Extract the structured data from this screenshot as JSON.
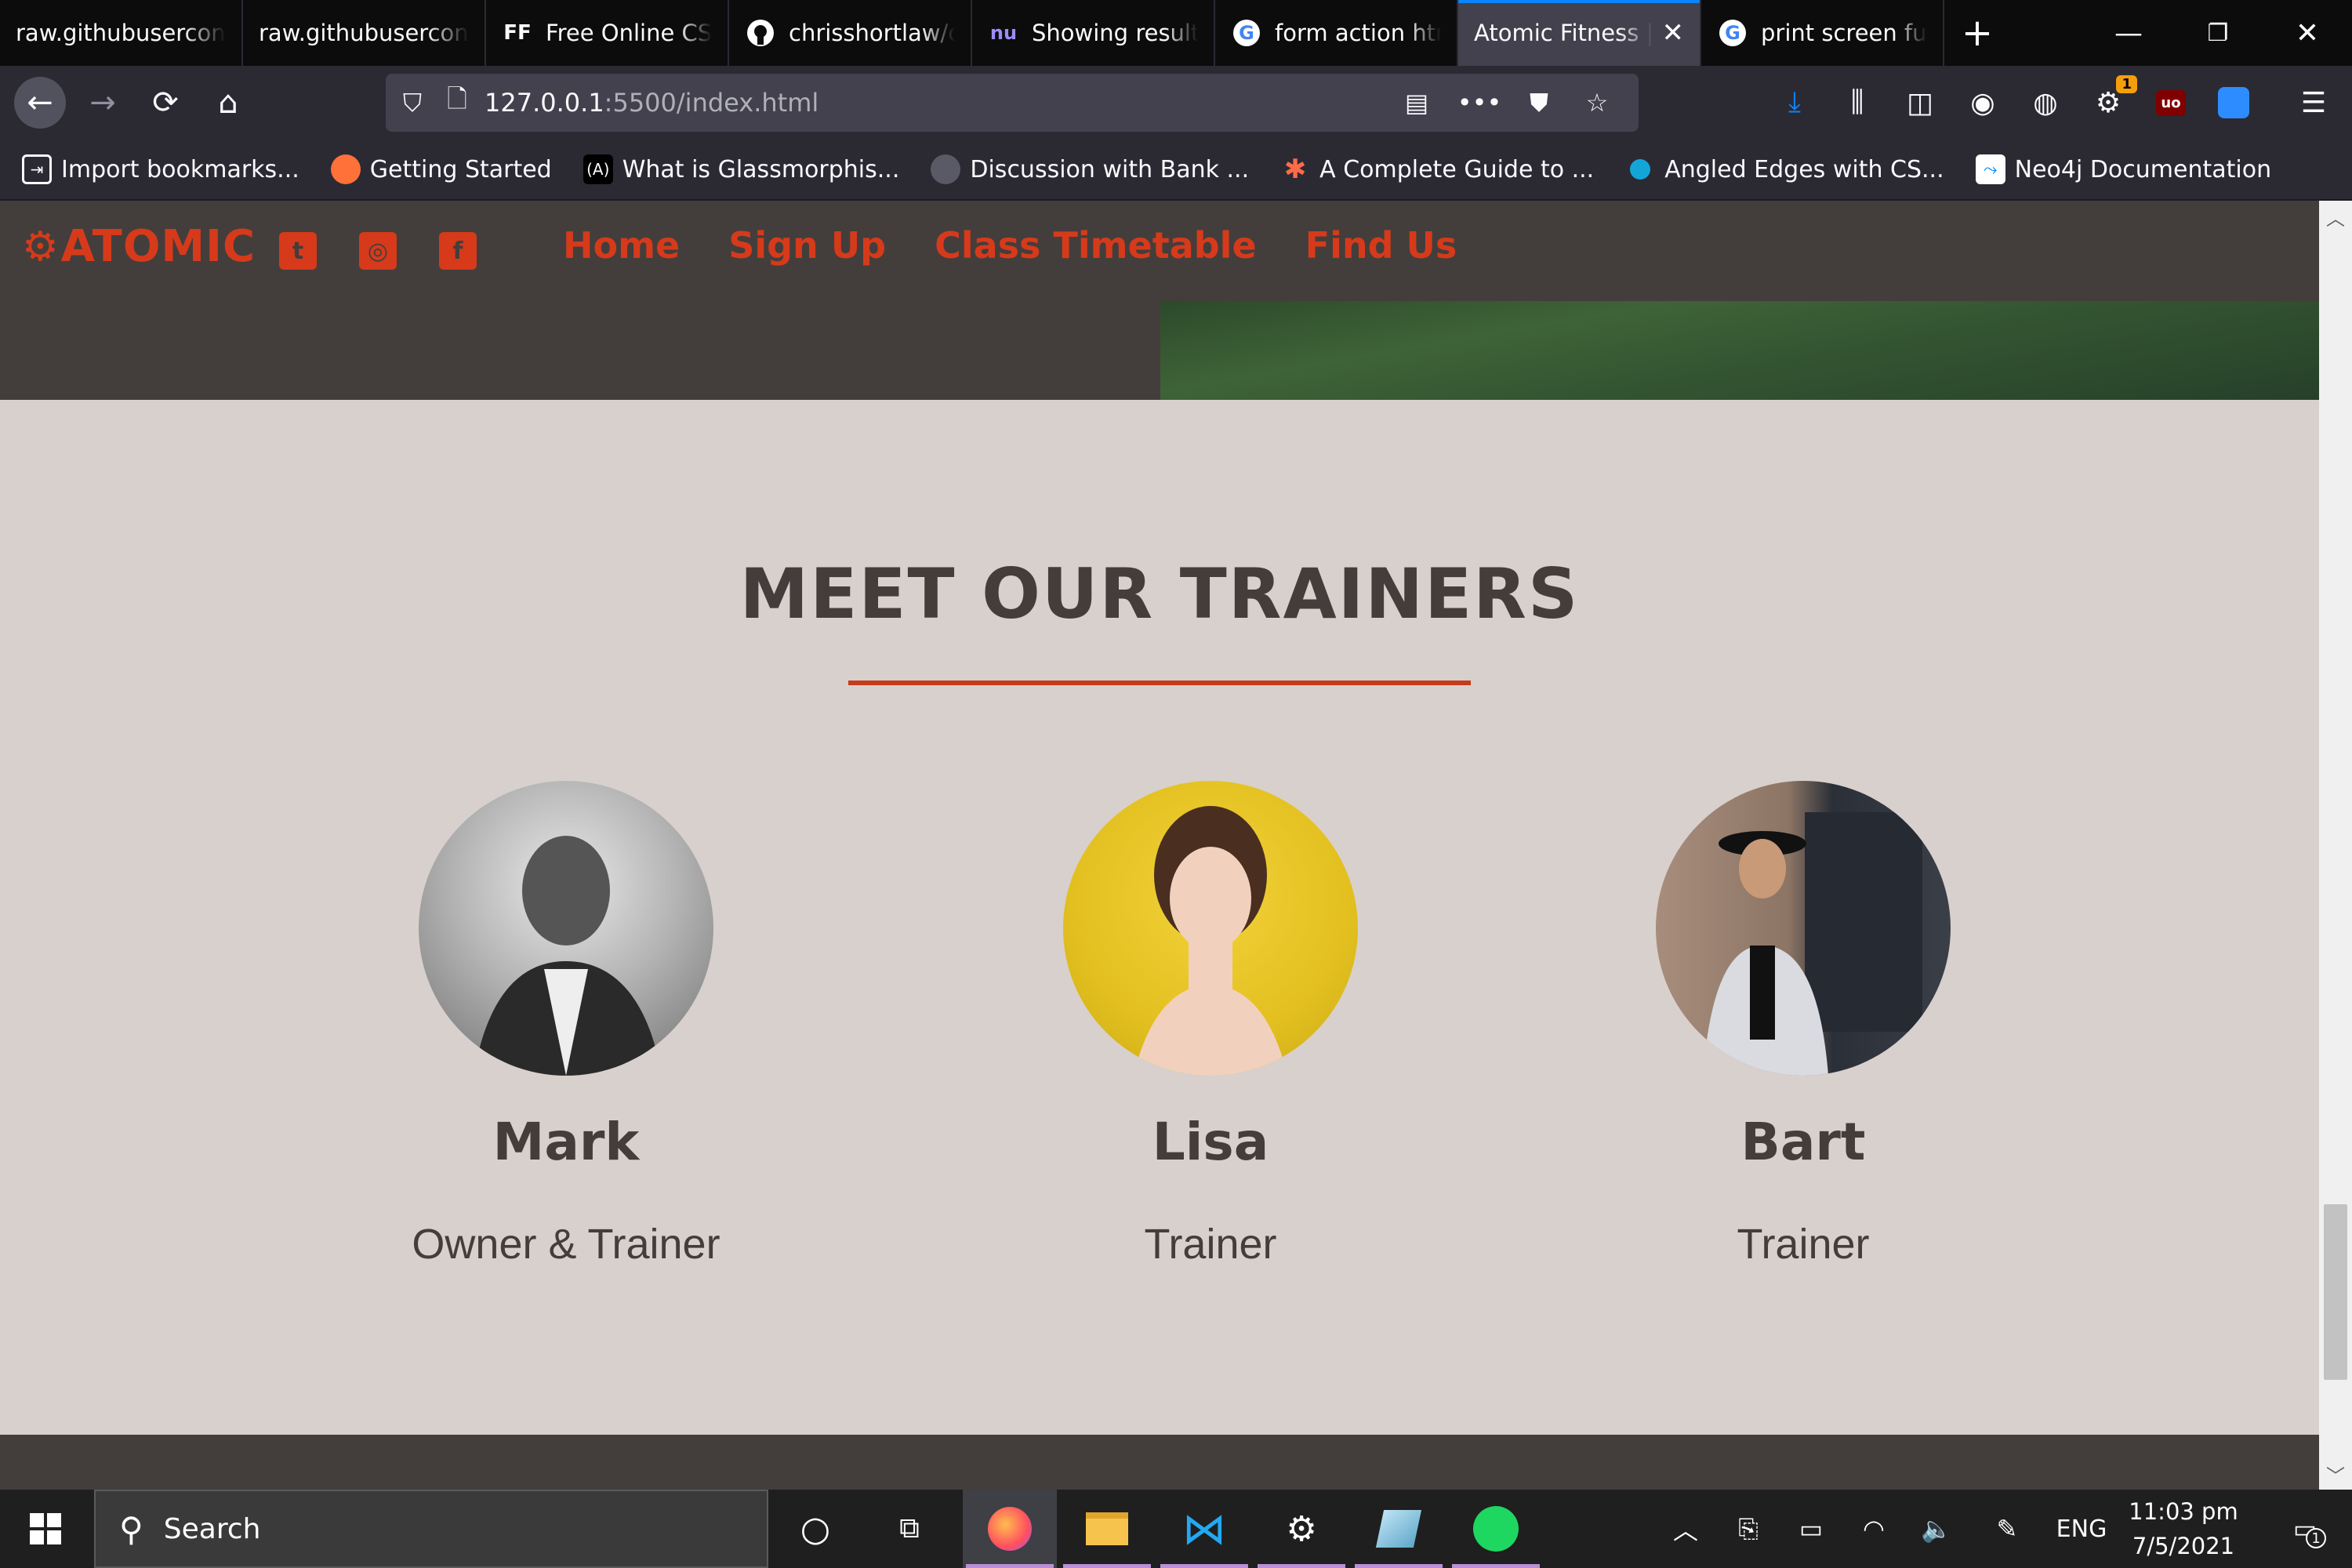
{
  "browser": {
    "tabs": [
      {
        "label": "raw.githubusercontent.com",
        "icon": ""
      },
      {
        "label": "raw.githubusercontent.com",
        "icon": ""
      },
      {
        "label": "Free Online CSS",
        "icon": "FF"
      },
      {
        "label": "chrisshortlaw/c",
        "icon": "github-icon"
      },
      {
        "label": "Showing results",
        "icon": "nu"
      },
      {
        "label": "form action htm",
        "icon": "google-icon"
      },
      {
        "label": "Atomic Fitness |",
        "icon": "",
        "active": true
      },
      {
        "label": "print screen fun",
        "icon": "google-icon"
      }
    ],
    "url_host": "127.0.0.1",
    "url_rest": ":5500/index.html",
    "extension_badge": "1",
    "bookmarks": [
      {
        "label": "Import bookmarks...",
        "icon": "import-icon"
      },
      {
        "label": "Getting Started",
        "icon": "firefox-icon"
      },
      {
        "label": "What is Glassmorphis...",
        "icon": "code-icon"
      },
      {
        "label": "Discussion with Bank ...",
        "icon": "globe-icon"
      },
      {
        "label": "A Complete Guide to ...",
        "icon": "asterisk-icon"
      },
      {
        "label": "Angled Edges with CS...",
        "icon": "dots-icon"
      },
      {
        "label": "Neo4j Documentation",
        "icon": "neo4j-icon"
      }
    ]
  },
  "site": {
    "logo": "ATOMIC",
    "nav": [
      "Home",
      "Sign Up",
      "Class Timetable",
      "Find Us"
    ],
    "section_title": "MEET OUR TRAINERS",
    "trainers": [
      {
        "name": "Mark",
        "role": "Owner & Trainer"
      },
      {
        "name": "Lisa",
        "role": "Trainer"
      },
      {
        "name": "Bart",
        "role": "Trainer"
      }
    ],
    "colors": {
      "accent": "#d63a1a",
      "dark": "#433e3c",
      "background": "#d8d0cd"
    }
  },
  "taskbar": {
    "search_placeholder": "Search",
    "language": "ENG",
    "time": "11:03 pm",
    "date": "7/5/2021",
    "notification_count": "1"
  }
}
